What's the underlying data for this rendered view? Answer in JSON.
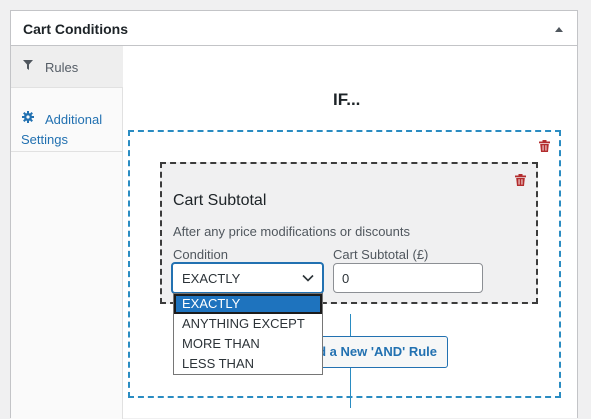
{
  "panel": {
    "title": "Cart Conditions"
  },
  "sidebar": {
    "tabs": [
      {
        "label": "Rules",
        "icon": "filter-icon"
      },
      {
        "label": "Additional Settings",
        "icon": "gear-icon"
      }
    ]
  },
  "main": {
    "heading": "IF...",
    "rule": {
      "title": "Cart Subtotal",
      "description": "After any price modifications or discounts",
      "condition_label": "Condition",
      "condition_value": "EXACTLY",
      "condition_options": [
        "EXACTLY",
        "ANYTHING EXCEPT",
        "MORE THAN",
        "LESS THAN"
      ],
      "subtotal_label": "Cart Subtotal (£)",
      "subtotal_value": "0"
    },
    "add_and_button_label": "Add a New 'AND' Rule"
  },
  "colors": {
    "accent": "#2271b1",
    "group_border": "#2a8cc2",
    "delete": "#b32d2e",
    "selected_option": "#1e73be"
  }
}
